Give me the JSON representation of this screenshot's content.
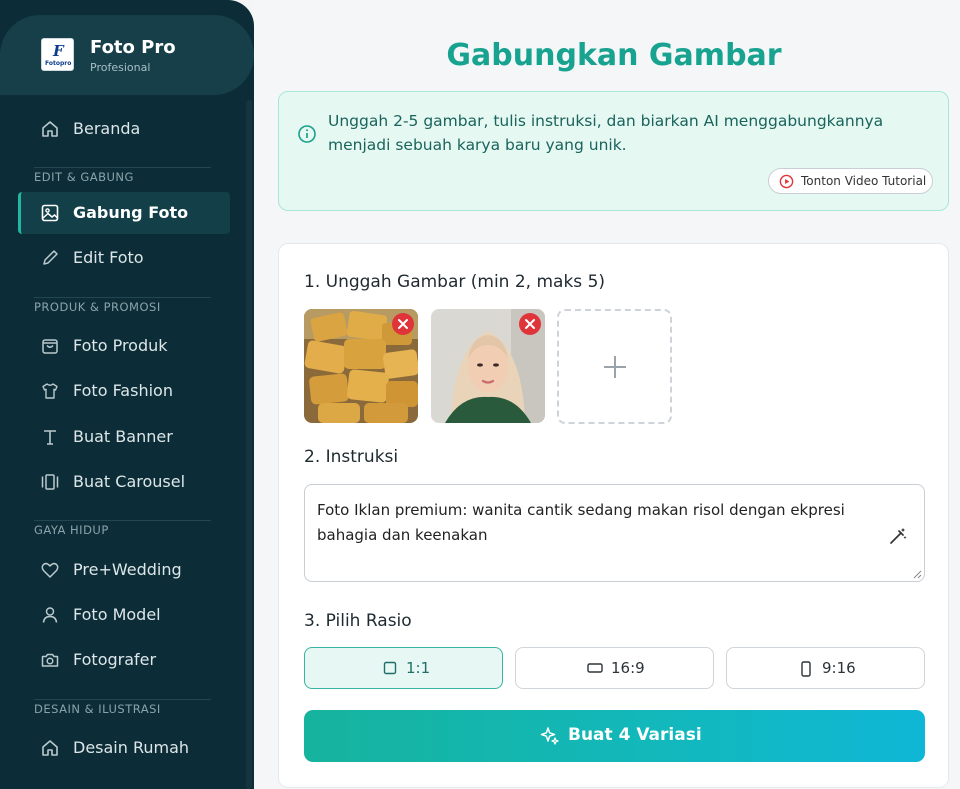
{
  "brand": {
    "name": "Foto Pro",
    "subtitle": "Profesional",
    "logo_letter": "F",
    "logo_text": "Fotopro"
  },
  "sidebar": {
    "home": "Beranda",
    "sections": [
      {
        "label": "EDIT & GABUNG",
        "items": [
          "Gabung Foto",
          "Edit Foto"
        ]
      },
      {
        "label": "PRODUK & PROMOSI",
        "items": [
          "Foto Produk",
          "Foto Fashion",
          "Buat Banner",
          "Buat Carousel"
        ]
      },
      {
        "label": "GAYA HIDUP",
        "items": [
          "Pre+Wedding",
          "Foto Model",
          "Fotografer"
        ]
      },
      {
        "label": "DESAIN & ILUSTRASI",
        "items": [
          "Desain Rumah"
        ]
      }
    ],
    "active": "Gabung Foto"
  },
  "main": {
    "title": "Gabungkan Gambar",
    "info_text": "Unggah 2-5 gambar, tulis instruksi, dan biarkan AI menggabungkannya menjadi sebuah karya baru yang unik.",
    "tutorial_label": "Tonton Video Tutorial",
    "step1": "1. Unggah Gambar (min 2, maks 5)",
    "step2": "2. Instruksi",
    "instruction_value": "Foto Iklan premium: wanita cantik sedang makan risol dengan ekpresi bahagia dan keenakan",
    "step3": "3. Pilih Rasio",
    "ratios": [
      "1:1",
      "16:9",
      "9:16"
    ],
    "selected_ratio": "1:1",
    "cta_label": "Buat 4 Variasi"
  },
  "colors": {
    "sidebar_bg": "#0c2d37",
    "accent": "#17a38f",
    "info_bg": "#e6f8f2",
    "remove_red": "#e0343b"
  },
  "icons": {
    "home": "home-icon",
    "gabung": "image-icon",
    "edit": "pencil-icon",
    "produk": "shopping-bag-icon",
    "fashion": "shirt-icon",
    "banner": "text-icon",
    "carousel": "carousel-icon",
    "wedding": "heart-icon",
    "model": "user-icon",
    "fotografer": "camera-icon",
    "rumah": "home-icon",
    "info": "info-icon",
    "tutorial": "play-circle-icon",
    "add": "plus-icon",
    "wand": "magic-wand-icon",
    "cta": "sparkles-icon"
  }
}
